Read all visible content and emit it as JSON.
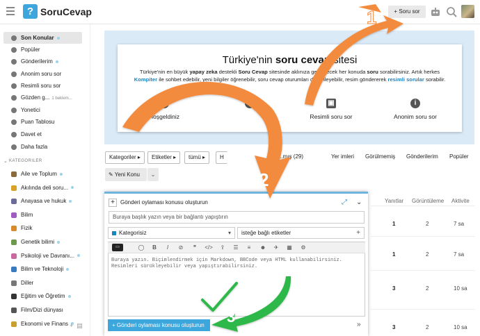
{
  "header": {
    "logo_glyph": "?",
    "logo_text": "SoruCevap",
    "ask_button": "Soru sor"
  },
  "sidebar": {
    "items": [
      {
        "label": "Son Konular",
        "icon": "layers-icon",
        "dot": true
      },
      {
        "label": "Popüler",
        "icon": "chart-icon",
        "dot": false
      },
      {
        "label": "Gönderilerim",
        "icon": "user-icon",
        "dot": true
      },
      {
        "label": "Anonim soru sor",
        "icon": "user-secret-icon",
        "dot": false
      },
      {
        "label": "Resimli soru sor",
        "icon": "user-image-icon",
        "dot": false
      },
      {
        "label": "Gözden g...",
        "icon": "eye-icon",
        "note": "1 beklem..."
      },
      {
        "label": "Yonetici",
        "icon": "wrench-icon",
        "dot": false
      },
      {
        "label": "Puan Tablosu",
        "icon": "trophy-icon",
        "dot": false
      },
      {
        "label": "Davet et",
        "icon": "send-icon",
        "dot": false
      },
      {
        "label": "Daha fazla",
        "icon": "more-icon",
        "dot": false
      }
    ],
    "categories_heading": "KATEGORILER",
    "categories": [
      {
        "label": "Aile ve Toplum",
        "color": "#8a6a3a",
        "dot": true
      },
      {
        "label": "Akılında deli soru...",
        "color": "#d9a22a",
        "dot": true
      },
      {
        "label": "Anayasa ve hukuk",
        "color": "#6c6c9a",
        "dot": true
      },
      {
        "label": "Bilim",
        "color": "#a05cc0",
        "dot": false
      },
      {
        "label": "Fizik",
        "color": "#d98a2a",
        "dot": false
      },
      {
        "label": "Genetik bilimi",
        "color": "#6a9a4a",
        "dot": true
      },
      {
        "label": "Psikoloji ve Davranı...",
        "color": "#c86aa0",
        "dot": true
      },
      {
        "label": "Bilim ve Teknoloji",
        "color": "#3a7ac0",
        "dot": true
      },
      {
        "label": "Diller",
        "color": "#777777",
        "dot": false
      },
      {
        "label": "Eğitim ve Öğretim",
        "color": "#333333",
        "dot": true
      },
      {
        "label": "Film/Dizi dünyası",
        "color": "#555555",
        "dot": false
      },
      {
        "label": "Ekonomi ve Finans",
        "color": "#c9a030",
        "dot": true
      }
    ]
  },
  "banner": {
    "title_pre": "Türkiye'nin ",
    "title_bold": "soru cevap",
    "title_post": " sitesi",
    "desc_1": "Türkiye'nin en büyük ",
    "desc_2": "yapay zeka",
    "desc_3": " destekli ",
    "desc_4": "Soru Cevap",
    "desc_5": " sitesinde aklınıza gelebilecek her konuda ",
    "desc_6": "soru",
    "desc_7": " sorabilirsiniz. Artık herkes ",
    "desc_8": "Kompiter",
    "desc_9": " ile sohbet edebilir, yeni bilgiler öğrenebilir, soru cevap oturumları düzenleyebilir, resim göndererek ",
    "desc_10": "resimli sorular",
    "desc_11": " sorabilir.",
    "features": [
      {
        "glyph": "i",
        "label": "Hoşgeldiniz"
      },
      {
        "glyph": "i",
        "label": ""
      },
      {
        "glyph": "▣",
        "label": "Resimli soru sor"
      },
      {
        "glyph": "i",
        "label": "Anonim soru sor"
      }
    ]
  },
  "nav": {
    "dropdowns": [
      "Kategoriler",
      "Etiketler",
      "tümü"
    ],
    "partial_dropdown": "H",
    "tabs": [
      "...mış (29)",
      "Yer imleri",
      "Görülmemiş",
      "Gönderilerim",
      "Popüler"
    ],
    "new_topic": "Yeni Konu"
  },
  "table": {
    "headers": [
      "Yanıtlar",
      "Görüntüleme",
      "Aktivite"
    ],
    "rows": [
      {
        "replies": "1",
        "views": "2",
        "activity": "7 sa"
      },
      {
        "replies": "1",
        "views": "2",
        "activity": "7 sa"
      },
      {
        "replies": "3",
        "views": "2",
        "activity": "10 sa"
      },
      {
        "replies": "3",
        "views": "2",
        "activity": "10 sa"
      }
    ]
  },
  "composer": {
    "action": "Gönderi oylaması konusu oluşturun",
    "title_placeholder": "Buraya başlık yazın veya bir bağlantı yapıştırın",
    "category": "Kategorisiz",
    "tags_placeholder": "isteğe bağlı etiketler",
    "editor_placeholder_1": "Buraya yazın. Biçimlendirmek için Markdown, BBCode veya HTML kullanabilirsiniz.",
    "editor_placeholder_2": "Resimleri sürükleyebilir veya yapıştırabilirsiniz.",
    "submit": "Gönderi oylaması konusu oluşturun"
  },
  "annotations": {
    "step_1": "1",
    "step_2": "2",
    "step_3": "3",
    "orange": "#f28b3c",
    "green": "#2db84a"
  }
}
